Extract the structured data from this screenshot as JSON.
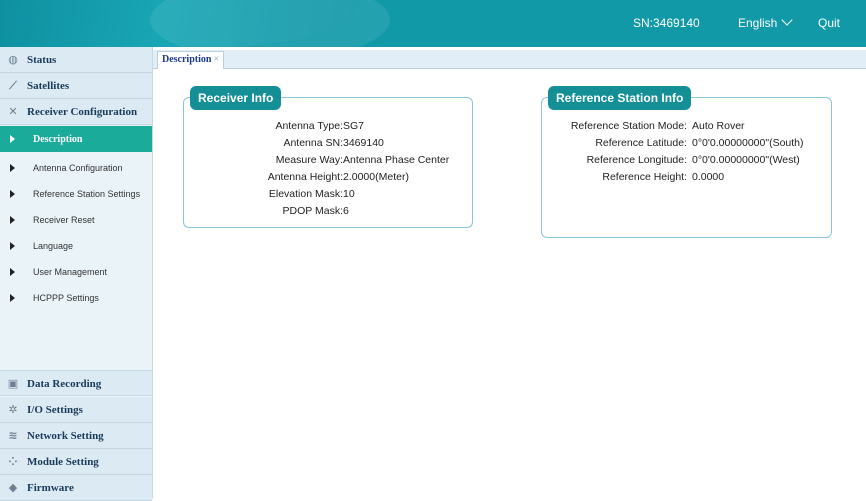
{
  "header": {
    "sn": "SN:3469140",
    "language": "English",
    "quit": "Quit"
  },
  "sidebar": {
    "sections_top": [
      {
        "label": "Status",
        "icon": "status-icon"
      },
      {
        "label": "Satellites",
        "icon": "satellite-icon"
      },
      {
        "label": "Receiver Configuration",
        "icon": "tools-icon"
      }
    ],
    "sub_items": [
      {
        "label": "Description",
        "active": true
      },
      {
        "label": "Antenna Configuration"
      },
      {
        "label": "Reference Station Settings"
      },
      {
        "label": "Receiver Reset"
      },
      {
        "label": "Language"
      },
      {
        "label": "User Management"
      },
      {
        "label": "HCPPP Settings"
      }
    ],
    "sections_bottom": [
      {
        "label": "Data Recording",
        "icon": "data-recording-icon"
      },
      {
        "label": "I/O Settings",
        "icon": "gear-icon"
      },
      {
        "label": "Network Setting",
        "icon": "wifi-icon"
      },
      {
        "label": "Module Setting",
        "icon": "module-icon"
      },
      {
        "label": "Firmware",
        "icon": "firmware-icon"
      }
    ]
  },
  "tabs": [
    {
      "label": "Description",
      "close": "×"
    }
  ],
  "receiver_info": {
    "title": "Receiver Info",
    "rows": [
      {
        "key": "Antenna Type:",
        "value": "SG7"
      },
      {
        "key": "Antenna SN:",
        "value": "3469140"
      },
      {
        "key": "Measure Way:",
        "value": "Antenna Phase Center"
      },
      {
        "key": "Antenna Height:",
        "value": "2.0000(Meter)"
      },
      {
        "key": "Elevation Mask:",
        "value": "10"
      },
      {
        "key": "PDOP Mask:",
        "value": "6"
      }
    ]
  },
  "reference_station_info": {
    "title": "Reference Station Info",
    "rows": [
      {
        "key": "Reference Station Mode:",
        "value": "Auto Rover"
      },
      {
        "key": "Reference Latitude:",
        "value": "0°0'0.00000000\"(South)"
      },
      {
        "key": "Reference Longitude:",
        "value": "0°0'0.00000000\"(West)"
      },
      {
        "key": "Reference Height:",
        "value": "0.0000"
      }
    ]
  }
}
